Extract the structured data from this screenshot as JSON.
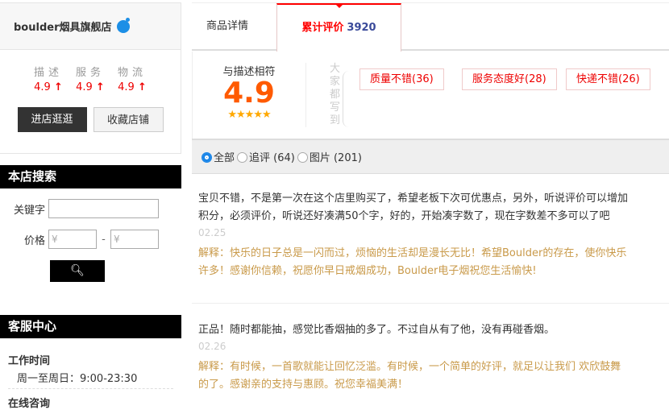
{
  "store": {
    "name": "boulder烟具旗舰店",
    "ratings": [
      {
        "label": "描述",
        "value": "4.9"
      },
      {
        "label": "服务",
        "value": "4.9"
      },
      {
        "label": "物流",
        "value": "4.9"
      }
    ],
    "enter_label": "进店逛逛",
    "favorite_label": "收藏店铺"
  },
  "search": {
    "title": "本店搜索",
    "keyword_label": "关键字",
    "keyword_value": "",
    "price_label": "价格",
    "price_min_placeholder": "¥",
    "price_max_placeholder": "¥",
    "dash": "-",
    "search_icon": "search-icon"
  },
  "service": {
    "title": "客服中心",
    "hours_title": "工作时间",
    "hours": "周一至周日：9:00-23:30",
    "consult_title": "在线咨询"
  },
  "tabs": [
    {
      "label": "商品详情"
    },
    {
      "label": "累计评价",
      "count": "3920"
    }
  ],
  "summary": {
    "label": "与描述相符",
    "score": "4.9",
    "stars": "★★★★★",
    "everyone_says": [
      "大",
      "家",
      "都",
      "写",
      "到"
    ],
    "tags": [
      "质量不错(36)",
      "服务态度好(28)",
      "快递不错(26)"
    ]
  },
  "filters": [
    {
      "label": "全部",
      "selected": true
    },
    {
      "label": "追评 (64)",
      "selected": false
    },
    {
      "label": "图片 (201)",
      "selected": false
    }
  ],
  "reviews": [
    {
      "lines": [
        "宝贝不错，不是第一次在这个店里购买了，希望老板下次可优惠点，另外，听说评价可以增加",
        "积分，必须评价，听说还好凑满50个字，好的，开始凑字数了，现在字数差不多可以了吧"
      ],
      "date": "02.25",
      "reply": [
        "解释：快乐的日子总是一闪而过，烦恼的生活却是漫长无比！希望Boulder的存在，使你快乐",
        "许多！感谢你信赖，祝愿你早日戒烟成功，Boulder电子烟祝您生活愉快!"
      ]
    },
    {
      "lines": [
        "正品！随时都能抽，感觉比香烟抽的多了。不过自从有了他，没有再碰香烟。"
      ],
      "date": "02.26",
      "reply": [
        "解释：有时候，一首歌就能让回忆泛滥。有时候，一个简单的好评，就足以让我们 欢欣鼓舞",
        "的了。感谢亲的支持与惠顾。祝您幸福美满！"
      ]
    }
  ]
}
